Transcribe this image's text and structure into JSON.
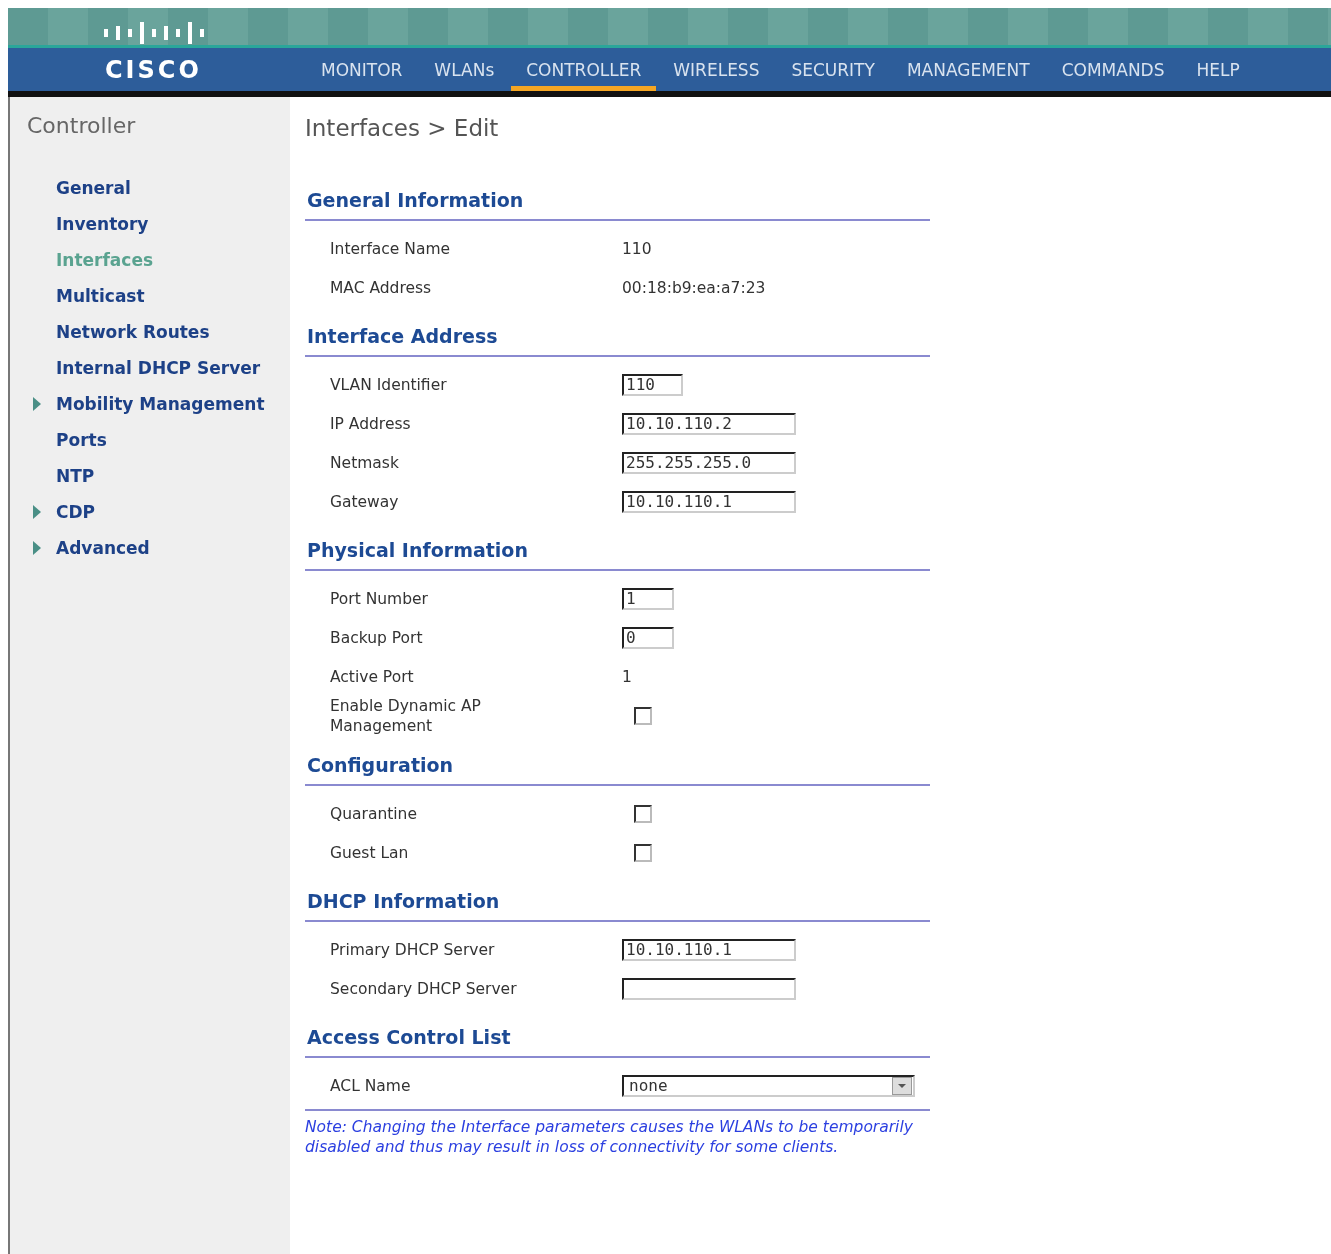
{
  "logo": {
    "text": "CISCO"
  },
  "nav": [
    {
      "label": "MONITOR",
      "selected": false
    },
    {
      "label": "WLANs",
      "selected": false
    },
    {
      "label": "CONTROLLER",
      "selected": true
    },
    {
      "label": "WIRELESS",
      "selected": false
    },
    {
      "label": "SECURITY",
      "selected": false
    },
    {
      "label": "MANAGEMENT",
      "selected": false
    },
    {
      "label": "COMMANDS",
      "selected": false
    },
    {
      "label": "HELP",
      "selected": false
    }
  ],
  "sidebar": {
    "title": "Controller",
    "items": [
      {
        "label": "General",
        "selected": false,
        "expandable": false
      },
      {
        "label": "Inventory",
        "selected": false,
        "expandable": false
      },
      {
        "label": "Interfaces",
        "selected": true,
        "expandable": false
      },
      {
        "label": "Multicast",
        "selected": false,
        "expandable": false
      },
      {
        "label": "Network Routes",
        "selected": false,
        "expandable": false
      },
      {
        "label": "Internal DHCP Server",
        "selected": false,
        "expandable": false
      },
      {
        "label": "Mobility Management",
        "selected": false,
        "expandable": true
      },
      {
        "label": "Ports",
        "selected": false,
        "expandable": false
      },
      {
        "label": "NTP",
        "selected": false,
        "expandable": false
      },
      {
        "label": "CDP",
        "selected": false,
        "expandable": true
      },
      {
        "label": "Advanced",
        "selected": false,
        "expandable": true
      }
    ]
  },
  "page_title": "Interfaces > Edit",
  "sections": [
    {
      "title": "General Information",
      "rows": [
        {
          "kind": "text",
          "label": "Interface Name",
          "value": "110"
        },
        {
          "kind": "text",
          "label": "MAC Address",
          "value": "00:18:b9:ea:a7:23"
        }
      ]
    },
    {
      "title": "Interface Address",
      "rows": [
        {
          "kind": "short-input",
          "label": "VLAN Identifier",
          "value": "110"
        },
        {
          "kind": "input",
          "label": "IP Address",
          "value": "10.10.110.2"
        },
        {
          "kind": "input",
          "label": "Netmask",
          "value": "255.255.255.0"
        },
        {
          "kind": "input",
          "label": "Gateway",
          "value": "10.10.110.1"
        }
      ]
    },
    {
      "title": "Physical Information",
      "rows": [
        {
          "kind": "tiny-input",
          "label": "Port Number",
          "value": "1"
        },
        {
          "kind": "tiny-input",
          "label": "Backup Port",
          "value": "0"
        },
        {
          "kind": "text",
          "label": "Active Port",
          "value": "1"
        },
        {
          "kind": "checkbox",
          "label": "Enable Dynamic AP Management",
          "checked": false
        }
      ]
    },
    {
      "title": "Configuration",
      "rows": [
        {
          "kind": "checkbox",
          "label": "Quarantine",
          "checked": false
        },
        {
          "kind": "checkbox",
          "label": "Guest Lan",
          "checked": false
        }
      ]
    },
    {
      "title": "DHCP Information",
      "rows": [
        {
          "kind": "input",
          "label": "Primary DHCP Server",
          "value": "10.10.110.1"
        },
        {
          "kind": "input",
          "label": "Secondary DHCP Server"
        }
      ]
    },
    {
      "title": "Access Control List",
      "rows": [
        {
          "kind": "select",
          "label": "ACL Name",
          "value": "none"
        }
      ]
    }
  ],
  "note": "Note: Changing the Interface parameters causes the WLANs to be temporarily disabled and thus may result in loss of connectivity for some clients."
}
